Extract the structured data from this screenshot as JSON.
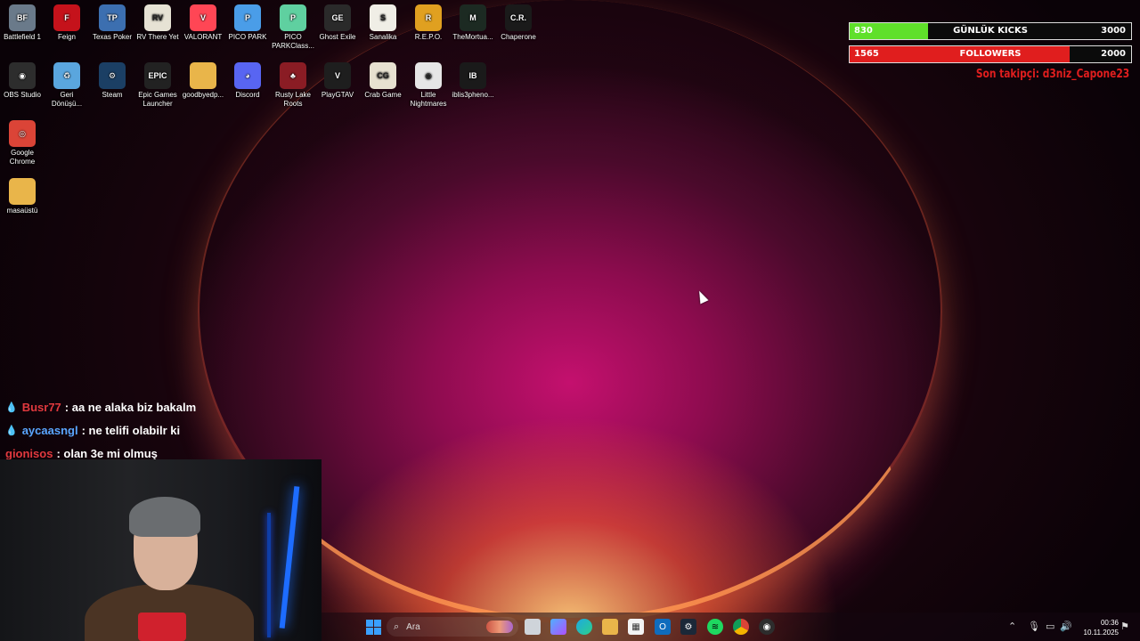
{
  "desktop_icons": [
    {
      "label": "Battlefield 1",
      "icon": "battlefield-icon",
      "color": "#6a7a8a",
      "glyph": "BF"
    },
    {
      "label": "Feign",
      "icon": "feign-icon",
      "color": "#c5121b",
      "glyph": "F"
    },
    {
      "label": "Texas Poker",
      "icon": "texas-poker-icon",
      "color": "#3c6fb0",
      "glyph": "TP"
    },
    {
      "label": "RV There Yet",
      "icon": "rv-there-yet-icon",
      "color": "#e6e2d4",
      "glyph": "RV"
    },
    {
      "label": "VALORANT",
      "icon": "valorant-icon",
      "color": "#ff4655",
      "glyph": "V"
    },
    {
      "label": "PICO PARK",
      "icon": "pico-park-icon",
      "color": "#4a9de8",
      "glyph": "P"
    },
    {
      "label": "PICO PARKClass...",
      "icon": "pico-park-classic-icon",
      "color": "#5fd0a0",
      "glyph": "P"
    },
    {
      "label": "Ghost Exile",
      "icon": "ghost-exile-icon",
      "color": "#2a2a2a",
      "glyph": "GE"
    },
    {
      "label": "Sanalika",
      "icon": "sanalika-icon",
      "color": "#f0eee6",
      "glyph": "S"
    },
    {
      "label": "R.E.P.O.",
      "icon": "repo-icon",
      "color": "#e0a020",
      "glyph": "R"
    },
    {
      "label": "TheMortua...",
      "icon": "the-mortuary-icon",
      "color": "#1c2a22",
      "glyph": "M"
    },
    {
      "label": "Chaperone",
      "icon": "chaperone-icon",
      "color": "#1a1a1a",
      "glyph": "C.R."
    },
    {
      "label": "OBS Studio",
      "icon": "obs-studio-icon",
      "color": "#2d2d2d",
      "glyph": "◉"
    },
    {
      "label": "Geri Dönüşü...",
      "icon": "recycle-bin-icon",
      "color": "#5aa6de",
      "glyph": "♻"
    },
    {
      "label": "Steam",
      "icon": "steam-icon",
      "color": "#1b3f64",
      "glyph": "⚙"
    },
    {
      "label": "Epic Games Launcher",
      "icon": "epic-games-icon",
      "color": "#222",
      "glyph": "EPIC"
    },
    {
      "label": "goodbyedp...",
      "icon": "folder-icon",
      "color": "#e9b54a",
      "glyph": ""
    },
    {
      "label": "Discord",
      "icon": "discord-icon",
      "color": "#5865f2",
      "glyph": "◕"
    },
    {
      "label": "Rusty Lake Roots",
      "icon": "rusty-lake-roots-icon",
      "color": "#8a1c24",
      "glyph": "♣"
    },
    {
      "label": "PlayGTAV",
      "icon": "gta-v-icon",
      "color": "#1e1e1e",
      "glyph": "V"
    },
    {
      "label": "Crab Game",
      "icon": "crab-game-icon",
      "color": "#e7e1d0",
      "glyph": "CG"
    },
    {
      "label": "Little Nightmares",
      "icon": "little-nightmares-icon",
      "color": "#e6e6e6",
      "glyph": "◉"
    },
    {
      "label": "iblis3pheno...",
      "icon": "iblis-icon",
      "color": "#1a1a1a",
      "glyph": "IB"
    },
    {
      "label": "Google Chrome",
      "icon": "chrome-icon",
      "color": "#db4437",
      "glyph": "◎"
    },
    {
      "label": "masaüstü",
      "icon": "folder-icon",
      "color": "#e9b54a",
      "glyph": ""
    }
  ],
  "widgets": {
    "kicks": {
      "current": "830",
      "label": "GÜNLÜK KICKS",
      "goal": "3000",
      "progress": 0.277,
      "color": "#5fe02a"
    },
    "followers": {
      "current": "1565",
      "label": "FOLLOWERS",
      "goal": "2000",
      "progress": 0.7825,
      "color": "#e01e1e"
    },
    "last_follower": "Son takipçi: d3niz_Capone23"
  },
  "chat": [
    {
      "user": "Busr77",
      "message": ": aa ne alaka biz bakalm",
      "user_color": "#e0393e",
      "drop": true
    },
    {
      "user": "aycaasngl",
      "message": ": ne telifi olabilr ki",
      "user_color": "#5aa6ff",
      "drop": true
    },
    {
      "user": "gionisos",
      "message": ": olan 3e mi olmuş",
      "user_color": "#e0393e",
      "drop": false
    }
  ],
  "taskbar": {
    "search_placeholder": "Ara",
    "clock_time": "00:36",
    "clock_date": "10.11.2025"
  }
}
